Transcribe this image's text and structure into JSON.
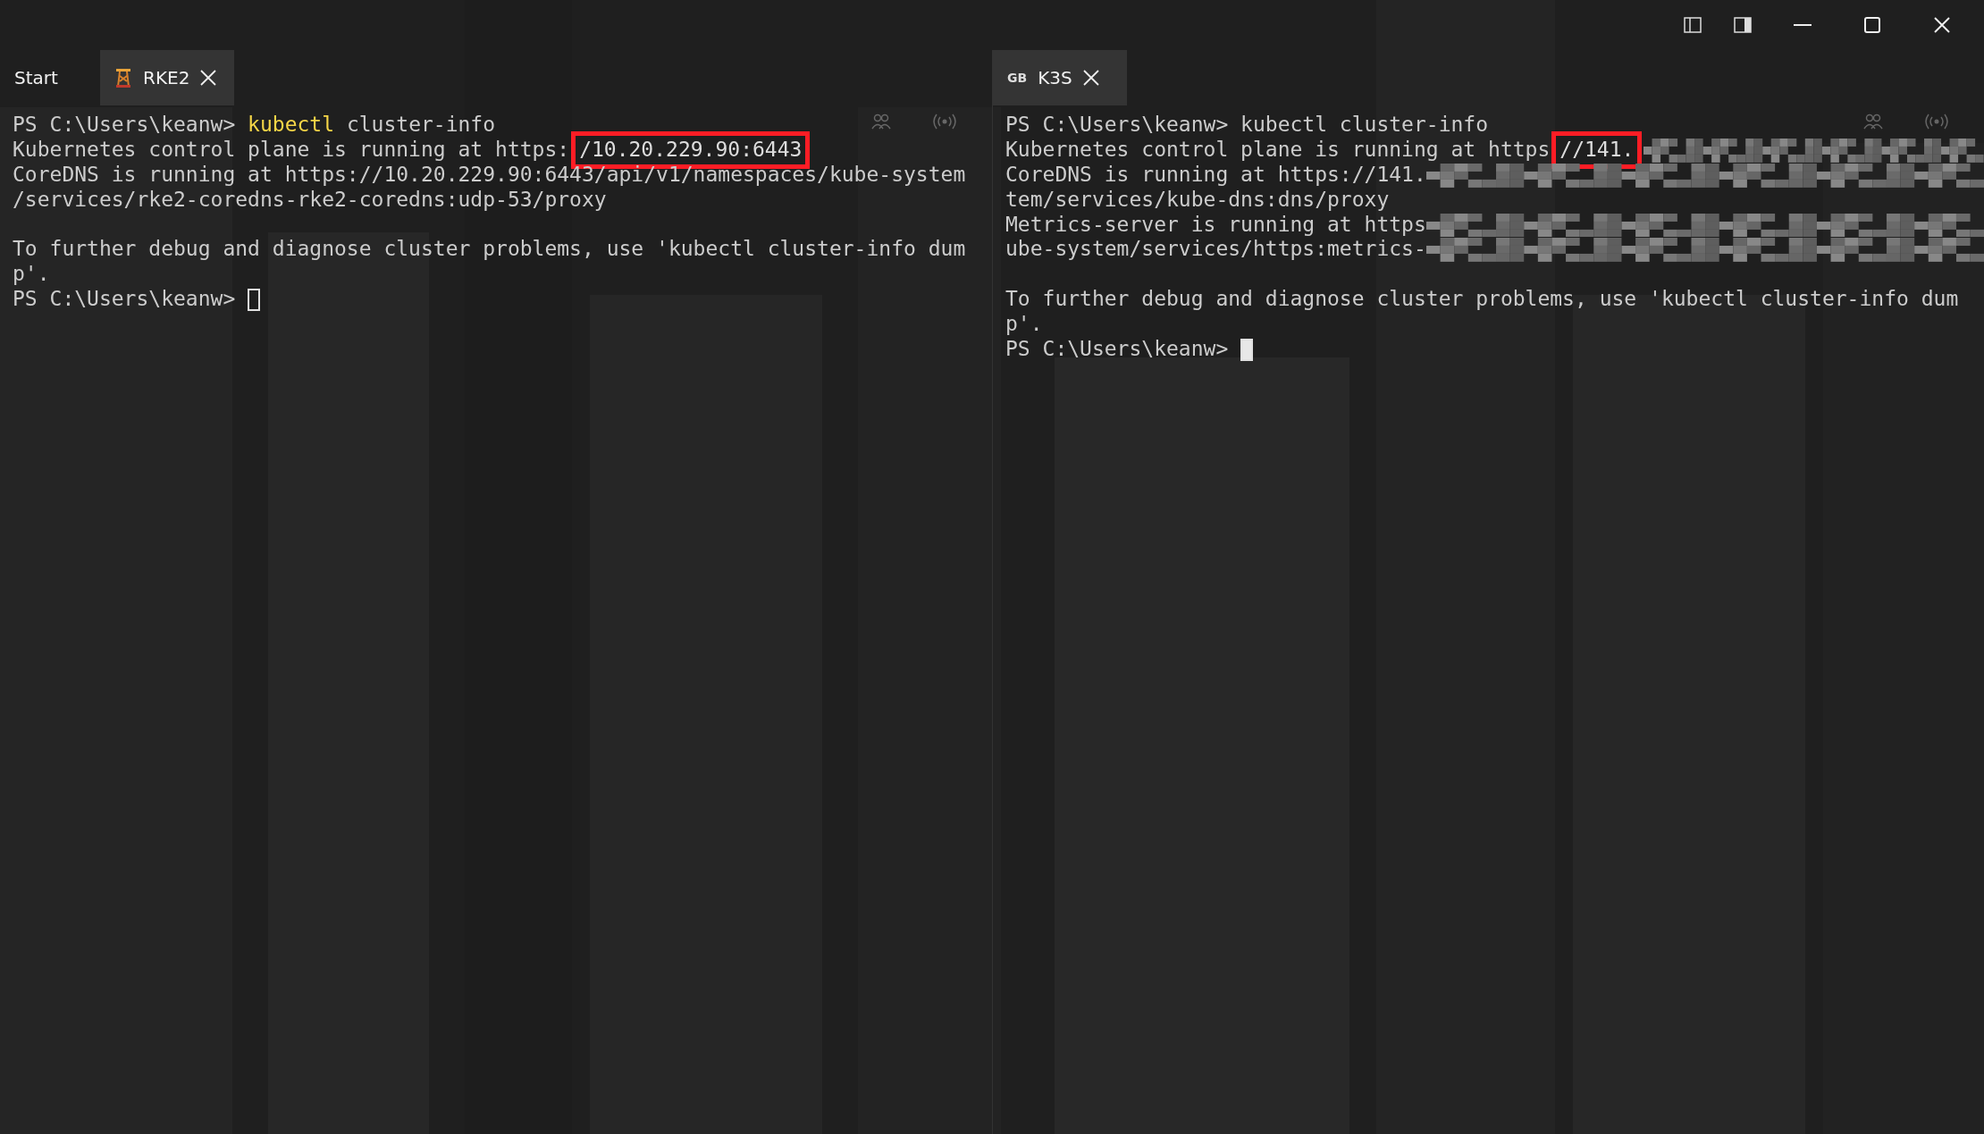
{
  "panes": [
    {
      "focused": false,
      "tabs": [
        {
          "label": "Start",
          "selected": false,
          "kind": "plain"
        },
        {
          "label": "RKE2",
          "selected": true,
          "kind": "emblem"
        }
      ],
      "lines": [
        {
          "segments": [
            {
              "kind": "text",
              "text": "PS C:\\Users\\keanw> "
            },
            {
              "kind": "command",
              "text": "kubectl"
            },
            {
              "kind": "text",
              "text": " cluster-info"
            }
          ]
        },
        {
          "segments": [
            {
              "kind": "text",
              "text": "Kubernetes control plane is running at https:"
            },
            {
              "kind": "highlight",
              "text": "/10.20.229.90:6443"
            }
          ]
        },
        {
          "segments": [
            {
              "kind": "text",
              "text": "CoreDNS is running at https://10.20.229.90:6443/api/v1/namespaces/kube-system"
            }
          ]
        },
        {
          "segments": [
            {
              "kind": "text",
              "text": "/services/rke2-coredns-rke2-coredns:udp-53/proxy"
            }
          ]
        },
        {
          "segments": [
            {
              "kind": "blank"
            }
          ]
        },
        {
          "segments": [
            {
              "kind": "text",
              "text": "To further debug and diagnose cluster problems, use 'kubectl cluster-info dum"
            }
          ]
        },
        {
          "segments": [
            {
              "kind": "text",
              "text": "p'."
            }
          ]
        },
        {
          "segments": [
            {
              "kind": "text",
              "text": "PS C:\\Users\\keanw> "
            },
            {
              "kind": "cursor"
            }
          ]
        }
      ]
    },
    {
      "focused": true,
      "tabs": [
        {
          "label": "K3S",
          "selected": true,
          "kind": "lettered",
          "icon_text": "GB"
        }
      ],
      "lines": [
        {
          "segments": [
            {
              "kind": "text",
              "text": "PS C:\\Users\\keanw> kubectl cluster-info"
            }
          ]
        },
        {
          "segments": [
            {
              "kind": "text",
              "text": "Kubernetes control plane is running at https"
            },
            {
              "kind": "highlight",
              "text": "//141."
            },
            {
              "kind": "redacted"
            }
          ]
        },
        {
          "segments": [
            {
              "kind": "text",
              "text": "CoreDNS is running at https://141."
            },
            {
              "kind": "redacted"
            }
          ]
        },
        {
          "segments": [
            {
              "kind": "text",
              "text": "tem/services/kube-dns:dns/proxy"
            }
          ]
        },
        {
          "segments": [
            {
              "kind": "text",
              "text": "Metrics-server is running at https"
            },
            {
              "kind": "redacted"
            }
          ]
        },
        {
          "segments": [
            {
              "kind": "text",
              "text": "ube-system/services/https:metrics-"
            },
            {
              "kind": "redacted"
            }
          ]
        },
        {
          "segments": [
            {
              "kind": "blank"
            }
          ]
        },
        {
          "segments": [
            {
              "kind": "text",
              "text": "To further debug and diagnose cluster problems, use 'kubectl cluster-info dum"
            }
          ]
        },
        {
          "segments": [
            {
              "kind": "text",
              "text": "p'."
            }
          ]
        },
        {
          "segments": [
            {
              "kind": "text",
              "text": "PS C:\\Users\\keanw> "
            },
            {
              "kind": "cursor"
            }
          ]
        }
      ]
    }
  ]
}
